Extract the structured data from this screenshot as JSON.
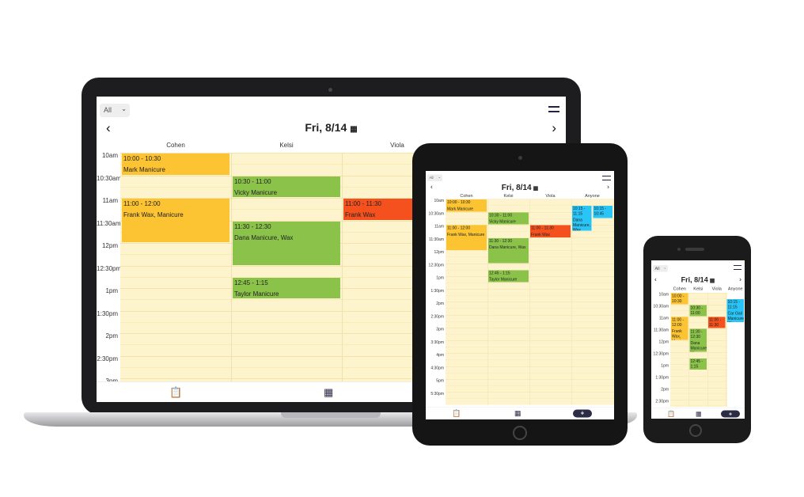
{
  "filter": {
    "selected": "All"
  },
  "date_title": "Fri, 8/14",
  "nav": {
    "prev": "‹",
    "next": "›"
  },
  "icons": {
    "calendar": "calendar-icon",
    "clipboard": "clipboard-icon",
    "menu": "menu-icon",
    "add": "plus-icon"
  },
  "laptop": {
    "columns": [
      "Cohen",
      "Kelsi",
      "Viola"
    ],
    "times": [
      "10am",
      "10:30am",
      "11am",
      "11:30am",
      "12pm",
      "12:30pm",
      "1pm",
      "1:30pm",
      "2pm",
      "2:30pm",
      "3pm"
    ],
    "appointments": [
      {
        "time": "10:00 - 10:30",
        "desc": "Mark Manicure",
        "color": "#fcc332"
      },
      {
        "time": "11:00 - 12:00",
        "desc": "Frank Wax, Manicure",
        "color": "#fcc332"
      },
      {
        "time": "10:30 - 11:00",
        "desc": "Vicky Manicure",
        "color": "#8bc34a"
      },
      {
        "time": "11:30 - 12:30",
        "desc": "Dana Manicure, Wax",
        "color": "#8bc34a"
      },
      {
        "time": "12:45 - 1:15",
        "desc": "Taylor Manicure",
        "color": "#8bc34a"
      },
      {
        "time": "11:00 - 11:30",
        "desc": "Frank Wax",
        "color": "#f4511e"
      }
    ]
  },
  "tablet": {
    "columns": [
      "Cohen",
      "Kelsi",
      "Viola",
      "Anyone"
    ],
    "times": [
      "10am",
      "10:30am",
      "11am",
      "11:30am",
      "12pm",
      "12:30pm",
      "1pm",
      "1:30pm",
      "2pm",
      "2:30pm",
      "3pm",
      "3:30pm",
      "4pm",
      "4:30pm",
      "5pm",
      "5:30pm"
    ],
    "appointments": [
      {
        "time": "10:00 - 10:30",
        "desc": "Mark Manicure",
        "color": "#fcc332"
      },
      {
        "time": "11:00 - 12:00",
        "desc": "Frank Wax, Manicure",
        "color": "#fcc332"
      },
      {
        "time": "10:30 - 11:00",
        "desc": "Vicky Manicure",
        "color": "#8bc34a"
      },
      {
        "time": "11:30 - 12:30",
        "desc": "Dana Manicure, Wax",
        "color": "#8bc34a"
      },
      {
        "time": "12:45 - 1:15",
        "desc": "Taylor Manicure",
        "color": "#8bc34a"
      },
      {
        "time": "11:00 - 11:30",
        "desc": "Frank Wax",
        "color": "#f4511e"
      },
      {
        "time": "10:15 - 11:15",
        "desc": "Dana Manicure, Wax",
        "color": "#29c5f6"
      },
      {
        "time": "10:15 - 10:45",
        "desc": "Dana Manicure, Wax",
        "color": "#29c5f6"
      }
    ]
  },
  "phone": {
    "columns": [
      "Cohen",
      "Kelsi",
      "Viola",
      "Anyone"
    ],
    "times": [
      "10am",
      "10:30am",
      "11am",
      "11:30am",
      "12pm",
      "12:30pm",
      "1pm",
      "1:30pm",
      "2pm",
      "2:30pm"
    ],
    "appointments": [
      {
        "time": "10:00 - 10:30",
        "desc": "Mark",
        "color": "#fcc332"
      },
      {
        "time": "11:00 - 12:00",
        "desc": "Frank Wax, Manicure",
        "color": "#fcc332"
      },
      {
        "time": "10:30 - 11:00",
        "desc": "Vicky",
        "color": "#8bc34a"
      },
      {
        "time": "11:30 - 12:30",
        "desc": "Dana Manicure Wax",
        "color": "#8bc34a"
      },
      {
        "time": "12:45 - 1:15",
        "desc": "Taylor",
        "color": "#8bc34a"
      },
      {
        "time": "11:00 - 11:30",
        "desc": "Frank",
        "color": "#f4511e"
      },
      {
        "time": "10:15 - 11:15",
        "desc": "Car Gail Manicure Wax",
        "color": "#29c5f6"
      }
    ]
  }
}
